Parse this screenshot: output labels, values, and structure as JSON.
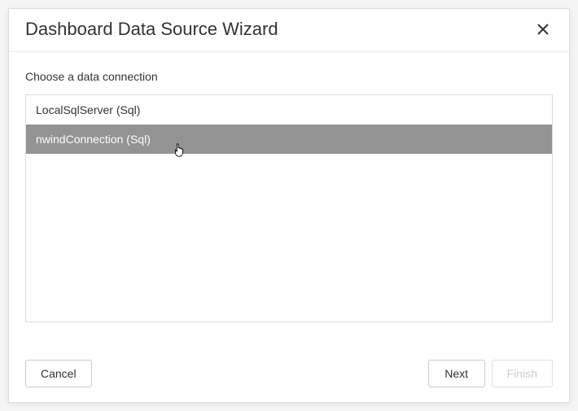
{
  "dialog": {
    "title": "Dashboard Data Source Wizard",
    "prompt": "Choose a data connection",
    "connections": [
      {
        "label": "LocalSqlServer (Sql)",
        "selected": false
      },
      {
        "label": "nwindConnection (Sql)",
        "selected": true
      }
    ],
    "buttons": {
      "cancel": "Cancel",
      "next": "Next",
      "finish": "Finish"
    }
  }
}
